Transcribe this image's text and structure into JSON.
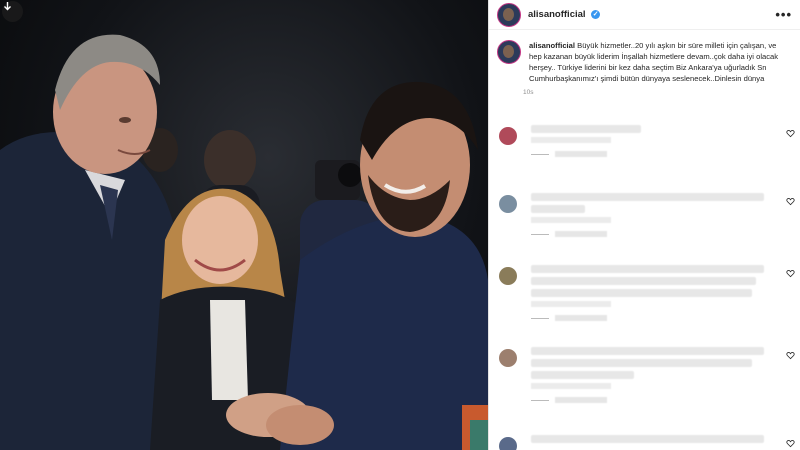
{
  "photo": {
    "download_icon": "download-arrow-icon"
  },
  "post": {
    "username": "alisanofficial",
    "more_icon": "more-options-icon",
    "caption_username": "alisanofficial",
    "caption": "Büyük hizmetler..20 yılı aşkın bir süre milleti için çalışan, ve hep kazanan büyük liderim İnşallah hizmetlere devam..çok daha iyi olacak herşey.. Türkiye liderini bir kez daha seçtim Biz Ankara'ya uğurladık Sn Cumhurbaşkanımız'ı şimdi bütün dünyaya seslenecek..Dinlesin dünya",
    "time": "10s"
  },
  "comments": [
    {
      "lines": [
        0.45
      ],
      "meta": true,
      "replies": true,
      "color": "#b04a5a"
    },
    {
      "lines": [
        0.95,
        0.22
      ],
      "meta": true,
      "replies": true,
      "color": "#7a8ea0"
    },
    {
      "lines": [
        0.95,
        0.92,
        0.9
      ],
      "meta": true,
      "replies": true,
      "color": "#8a7c5a"
    },
    {
      "lines": [
        0.95,
        0.9,
        0.42
      ],
      "meta": true,
      "replies": true,
      "color": "#9c7f6e"
    },
    {
      "lines": [
        0.95
      ],
      "meta": false,
      "replies": false,
      "color": "#5a6a8a"
    }
  ],
  "colors": {
    "accent": "#3897f0",
    "story_ring": "#c13584"
  }
}
